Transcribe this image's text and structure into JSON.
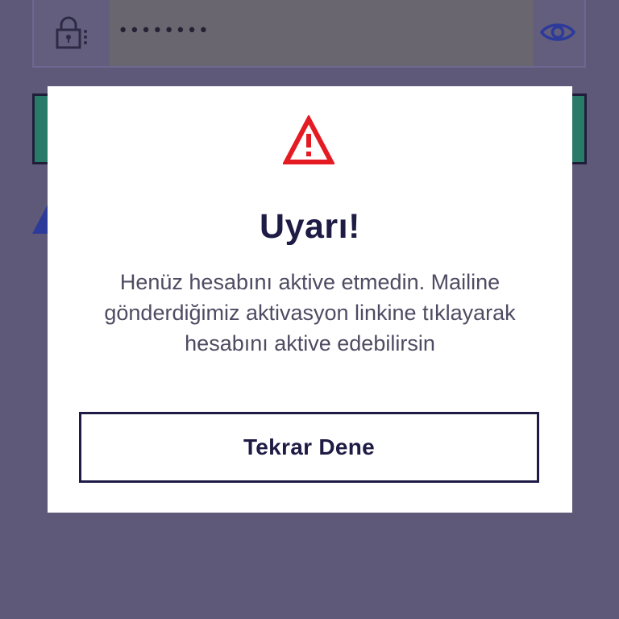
{
  "login_form": {
    "password_mask": "••••••••",
    "lock_icon": "lock-icon",
    "eye_icon": "eye-icon"
  },
  "modal": {
    "icon": "warning-icon",
    "title": "Uyarı!",
    "message": "Henüz hesabını aktive etmedin. Mailine gönderdiğimiz aktivasyon linkine tıklayarak hesabını aktive edebilirsin",
    "retry_label": "Tekrar Dene"
  },
  "colors": {
    "overlay_bg": "#5e5978",
    "modal_bg": "#ffffff",
    "title": "#1e1b45",
    "message": "#4e4b62",
    "warning": "#e51b23",
    "accent_green": "#2a7a6a",
    "eye_blue": "#2c3a9a"
  }
}
